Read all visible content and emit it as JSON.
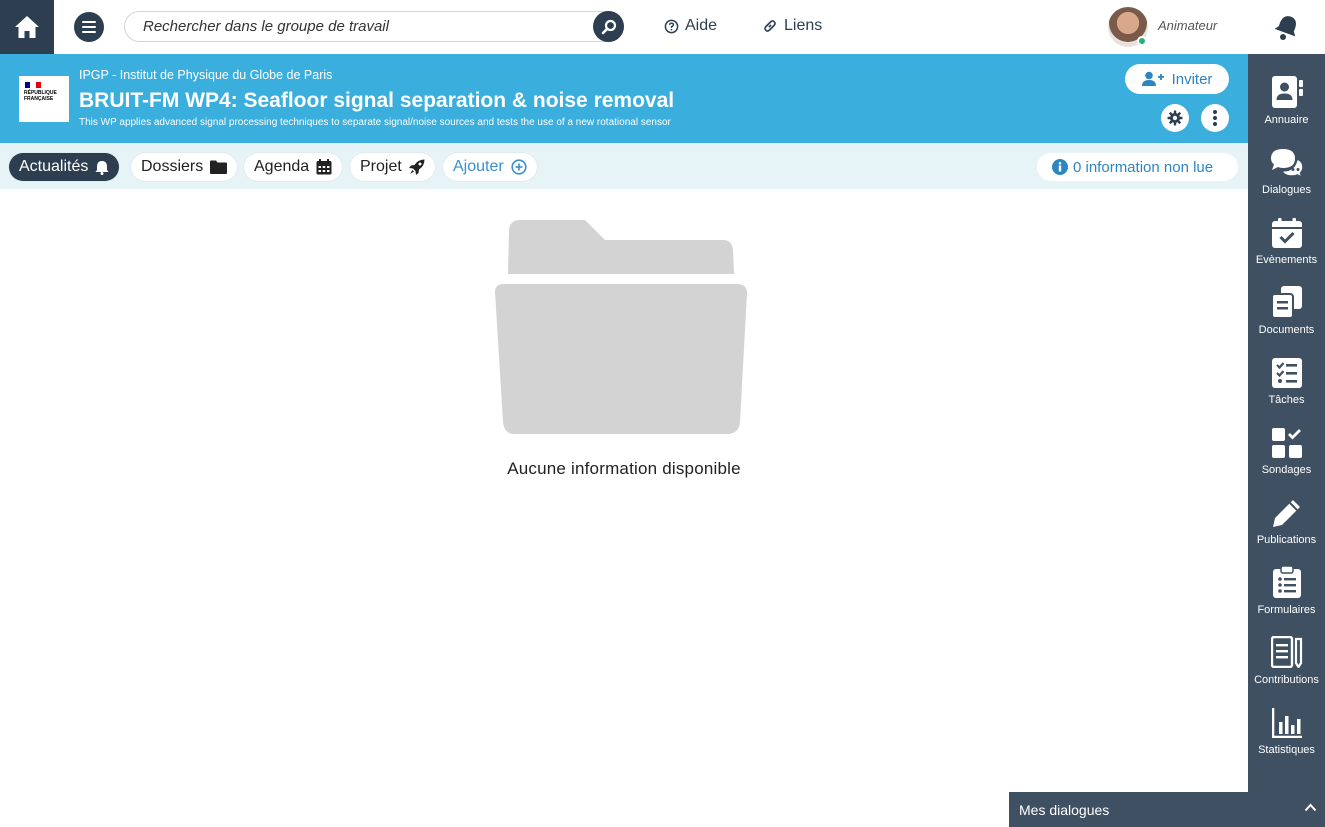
{
  "topbar": {
    "search_placeholder": "Rechercher dans le groupe de travail",
    "help_label": "Aide",
    "links_label": "Liens",
    "role": "Animateur"
  },
  "header": {
    "logo_text": "RÉPUBLIQUE FRANÇAISE",
    "org": "IPGP - Institut de Physique du Globe de Paris",
    "title": "BRUIT-FM WP4: Seafloor signal separation & noise removal",
    "subtitle": "This WP applies advanced signal processing techniques to separate signal/noise sources and tests the use of a new rotational sensor",
    "invite_label": "Inviter"
  },
  "tabs": [
    {
      "label": "Actualités",
      "icon": "bell-icon"
    },
    {
      "label": "Dossiers",
      "icon": "folder-icon"
    },
    {
      "label": "Agenda",
      "icon": "calendar-icon"
    },
    {
      "label": "Projet",
      "icon": "rocket-icon"
    },
    {
      "label": "Ajouter",
      "icon": "plus-circle-icon"
    }
  ],
  "unread_label": "0 information non lue",
  "empty_message": "Aucune information disponible",
  "sidebar": [
    {
      "label": "Annuaire",
      "icon": "address-book-icon"
    },
    {
      "label": "Dialogues",
      "icon": "comments-icon"
    },
    {
      "label": "Evènements",
      "icon": "calendar-check-icon"
    },
    {
      "label": "Documents",
      "icon": "copy-icon"
    },
    {
      "label": "Tâches",
      "icon": "tasks-icon"
    },
    {
      "label": "Sondages",
      "icon": "poll-icon"
    },
    {
      "label": "Publications",
      "icon": "pencil-icon"
    },
    {
      "label": "Formulaires",
      "icon": "clipboard-list-icon"
    },
    {
      "label": "Contributions",
      "icon": "contribution-icon"
    },
    {
      "label": "Statistiques",
      "icon": "chart-bar-icon"
    }
  ],
  "dialogs_bar_label": "Mes dialogues",
  "colors": {
    "dark": "#2c3e50",
    "header": "#3aaedc",
    "tabs_bg": "#e6f4f7",
    "sidebar": "#3f5062",
    "accent": "#2e86c1"
  }
}
